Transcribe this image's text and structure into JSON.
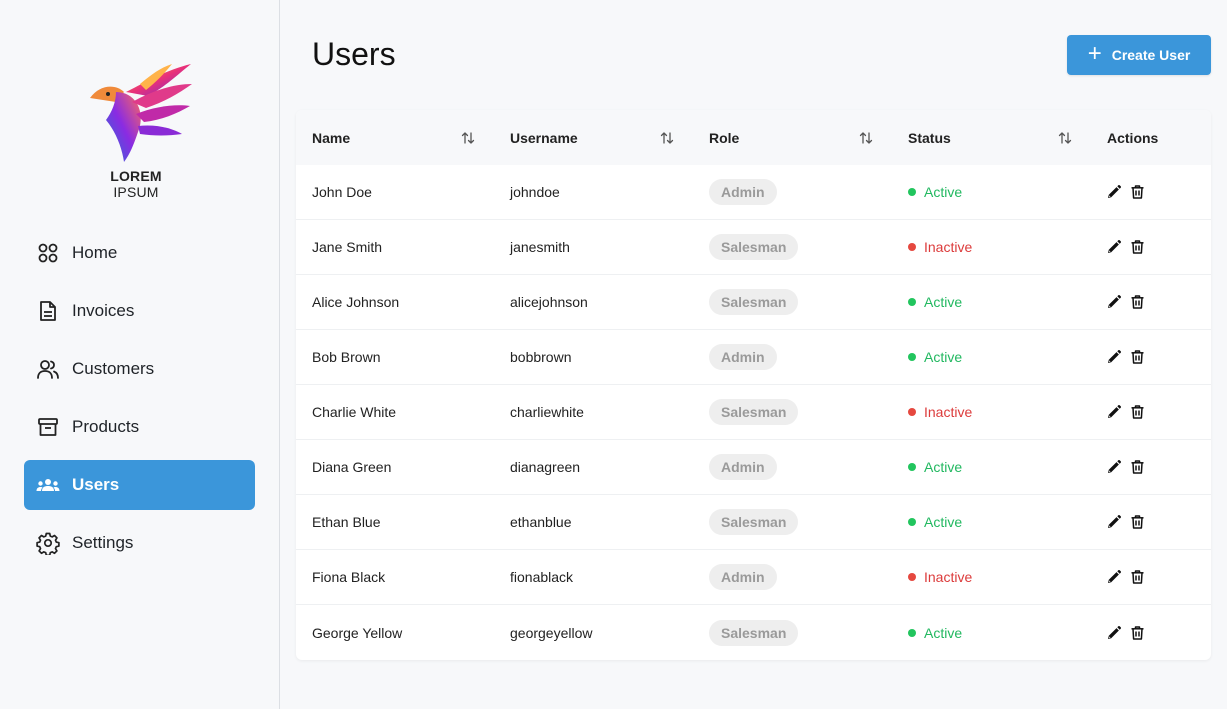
{
  "brand": {
    "logo_bold": "LOREM",
    "logo_light": "IPSUM"
  },
  "sidebar": {
    "items": [
      {
        "label": "Home",
        "icon": "grid-icon",
        "active": false
      },
      {
        "label": "Invoices",
        "icon": "document-icon",
        "active": false
      },
      {
        "label": "Customers",
        "icon": "customers-icon",
        "active": false
      },
      {
        "label": "Products",
        "icon": "archive-icon",
        "active": false
      },
      {
        "label": "Users",
        "icon": "users-icon",
        "active": true
      },
      {
        "label": "Settings",
        "icon": "gear-icon",
        "active": false
      }
    ]
  },
  "header": {
    "title": "Users",
    "create_label": "Create User"
  },
  "table": {
    "columns": [
      "Name",
      "Username",
      "Role",
      "Status",
      "Actions"
    ],
    "rows": [
      {
        "name": "John Doe",
        "username": "johndoe",
        "role": "Admin",
        "status": "Active"
      },
      {
        "name": "Jane Smith",
        "username": "janesmith",
        "role": "Salesman",
        "status": "Inactive"
      },
      {
        "name": "Alice Johnson",
        "username": "alicejohnson",
        "role": "Salesman",
        "status": "Active"
      },
      {
        "name": "Bob Brown",
        "username": "bobbrown",
        "role": "Admin",
        "status": "Active"
      },
      {
        "name": "Charlie White",
        "username": "charliewhite",
        "role": "Salesman",
        "status": "Inactive"
      },
      {
        "name": "Diana Green",
        "username": "dianagreen",
        "role": "Admin",
        "status": "Active"
      },
      {
        "name": "Ethan Blue",
        "username": "ethanblue",
        "role": "Salesman",
        "status": "Active"
      },
      {
        "name": "Fiona Black",
        "username": "fionablack",
        "role": "Admin",
        "status": "Inactive"
      },
      {
        "name": "George Yellow",
        "username": "georgeyellow",
        "role": "Salesman",
        "status": "Active"
      }
    ]
  },
  "colors": {
    "accent": "#3b96da",
    "active": "#22b860",
    "inactive": "#dc3b3b"
  }
}
